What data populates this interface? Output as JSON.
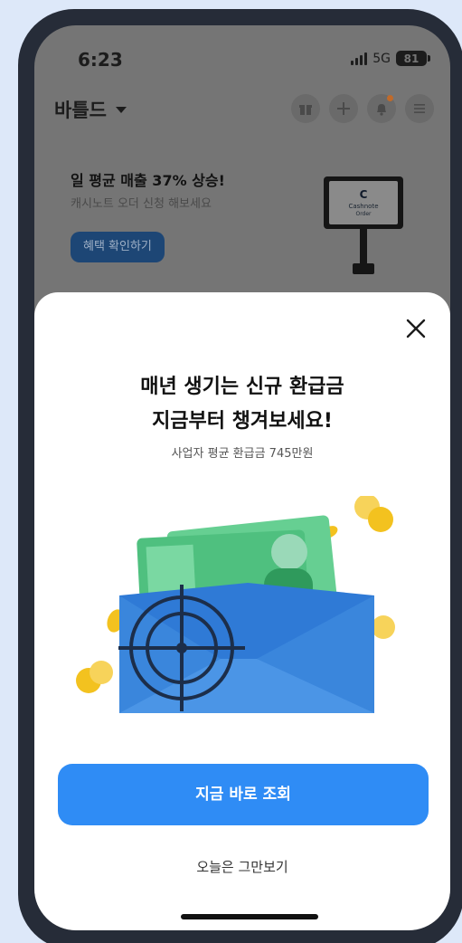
{
  "status_bar": {
    "time": "6:23",
    "network": "5G",
    "battery": "81"
  },
  "header": {
    "store_name": "바틀드",
    "icons": [
      "gift-icon",
      "plus-icon",
      "bell-icon",
      "menu-icon"
    ]
  },
  "banner": {
    "title": "일 평균 매출 37% 상승!",
    "subtitle": "캐시노트 오더 신청 해보세요",
    "button_label": "혜택 확인하기",
    "device_brand": "Cashnote",
    "device_label": "Order"
  },
  "modal": {
    "title_line1": "매년 생기는 신규 환급금",
    "title_line2": "지금부터 챙겨보세요!",
    "subtitle": "사업자 평균 환급금 745만원",
    "primary_button_label": "지금 바로 조회",
    "dismiss_label": "오늘은 그만보기"
  },
  "colors": {
    "accent": "#2f8cf5",
    "money_green": "#3fb873",
    "envelope_blue": "#3a86dc",
    "coin_gold": "#f3c21f",
    "frame": "#262c38",
    "background": "#dde8f9"
  }
}
